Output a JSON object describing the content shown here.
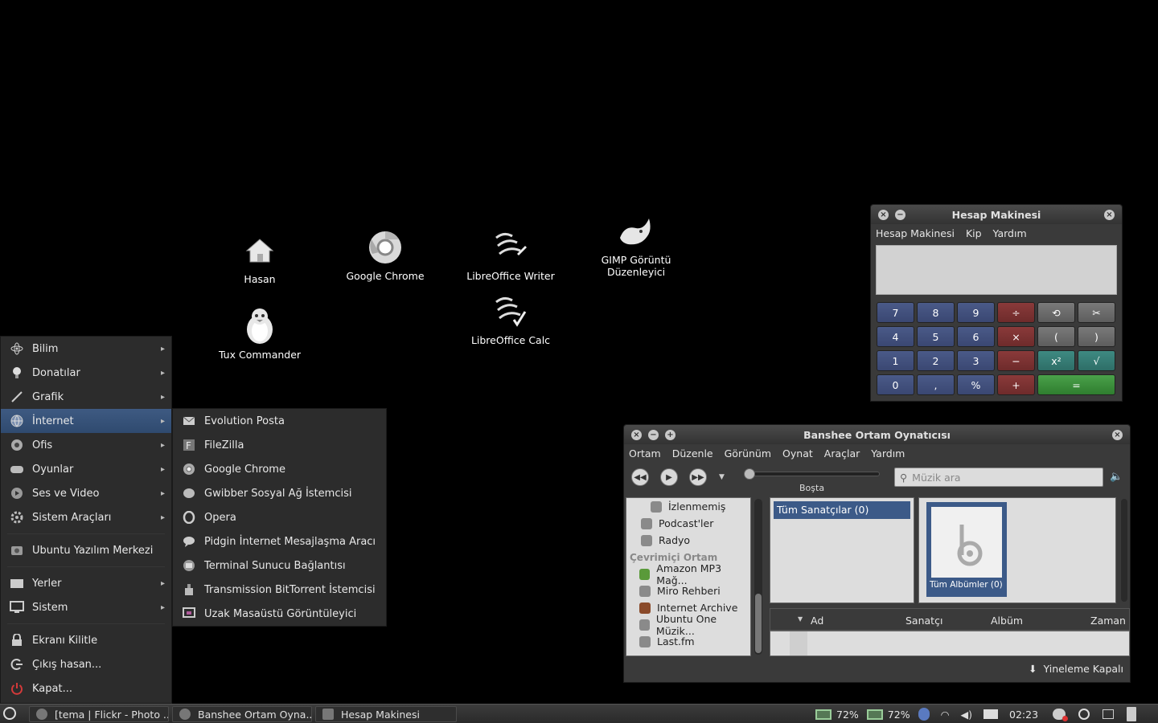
{
  "desktop": {
    "icons": [
      {
        "label": "Hasan",
        "icon": "home-folder-icon"
      },
      {
        "label": "Google Chrome",
        "icon": "chrome-icon"
      },
      {
        "label": "LibreOffice Writer",
        "icon": "libreoffice-writer-icon"
      },
      {
        "label": "GIMP Görüntü Düzenleyici",
        "icon": "gimp-icon"
      },
      {
        "label": "Tux Commander",
        "icon": "tux-icon"
      },
      {
        "label": "LibreOffice Calc",
        "icon": "libreoffice-calc-icon"
      }
    ]
  },
  "start_menu": {
    "items": [
      {
        "label": "Bilim",
        "icon": "science-icon"
      },
      {
        "label": "Donatılar",
        "icon": "accessories-icon"
      },
      {
        "label": "Grafik",
        "icon": "graphics-icon"
      },
      {
        "label": "İnternet",
        "icon": "internet-icon"
      },
      {
        "label": "Ofis",
        "icon": "office-icon"
      },
      {
        "label": "Oyunlar",
        "icon": "games-icon"
      },
      {
        "label": "Ses ve Video",
        "icon": "multimedia-icon"
      },
      {
        "label": "Sistem Araçları",
        "icon": "system-tools-icon"
      },
      {
        "label": "Ubuntu Yazılım Merkezi",
        "icon": "software-center-icon"
      },
      {
        "label": "Yerler",
        "icon": "places-icon"
      },
      {
        "label": "Sistem",
        "icon": "system-icon"
      },
      {
        "label": "Ekranı Kilitle",
        "icon": "lock-icon"
      },
      {
        "label": "Çıkış hasan...",
        "icon": "logout-icon"
      },
      {
        "label": "Kapat...",
        "icon": "power-icon"
      }
    ],
    "submenu": [
      {
        "label": "Evolution Posta",
        "icon": "mail-icon"
      },
      {
        "label": "FileZilla",
        "icon": "filezilla-icon"
      },
      {
        "label": "Google Chrome",
        "icon": "chrome-icon"
      },
      {
        "label": "Gwibber Sosyal Ağ İstemcisi",
        "icon": "gwibber-icon"
      },
      {
        "label": "Opera",
        "icon": "opera-icon"
      },
      {
        "label": "Pidgin İnternet Mesajlaşma Aracı",
        "icon": "pidgin-icon"
      },
      {
        "label": "Terminal Sunucu Bağlantısı",
        "icon": "terminal-server-icon"
      },
      {
        "label": "Transmission BitTorrent İstemcisi",
        "icon": "transmission-icon"
      },
      {
        "label": "Uzak Masaüstü Görüntüleyici",
        "icon": "remote-desktop-icon"
      }
    ]
  },
  "calculator": {
    "title": "Hesap Makinesi",
    "menu": [
      "Hesap Makinesi",
      "Kip",
      "Yardım"
    ],
    "display": "",
    "buttons": {
      "b7": "7",
      "b8": "8",
      "b9": "9",
      "div": "÷",
      "b4": "4",
      "b5": "5",
      "b6": "6",
      "mul": "×",
      "lparen": "(",
      "rparen": ")",
      "b1": "1",
      "b2": "2",
      "b3": "3",
      "sub": "−",
      "pow": "x²",
      "sqrt": "√",
      "b0": "0",
      "comma": ",",
      "pct": "%",
      "add": "+",
      "eq": "="
    }
  },
  "banshee": {
    "title": "Banshee Ortam Oynatıcısı",
    "menu": [
      "Ortam",
      "Düzenle",
      "Görünüm",
      "Oynat",
      "Araçlar",
      "Yardım"
    ],
    "status": "Boşta",
    "search_placeholder": "Müzik ara",
    "sources": [
      {
        "label": "İzlenmemiş",
        "icon": "unwatched-icon"
      },
      {
        "label": "Podcast'ler",
        "icon": "podcast-icon"
      },
      {
        "label": "Radyo",
        "icon": "radio-icon"
      }
    ],
    "online_header": "Çevrimiçi Ortam",
    "online_sources": [
      {
        "label": "Amazon MP3 Mağ...",
        "icon": "amazon-icon"
      },
      {
        "label": "Miro Rehberi",
        "icon": "miro-icon"
      },
      {
        "label": "Internet Archive",
        "icon": "archive-icon"
      },
      {
        "label": "Ubuntu One Müzik...",
        "icon": "ubuntu-one-icon"
      },
      {
        "label": "Last.fm",
        "icon": "lastfm-icon"
      }
    ],
    "artists": [
      "Tüm Sanatçılar (0)"
    ],
    "albums": [
      "Tüm Albümler (0)"
    ],
    "columns": [
      "Ad",
      "Sanatçı",
      "Albüm",
      "Zaman"
    ],
    "repeat": "Yineleme Kapalı"
  },
  "taskbar": {
    "tasks": [
      "[tema | Flickr - Photo ...",
      "Banshee Ortam Oyna...",
      "Hesap Makinesi"
    ],
    "battery1": "72%",
    "battery2": "72%",
    "clock": "02:23"
  }
}
